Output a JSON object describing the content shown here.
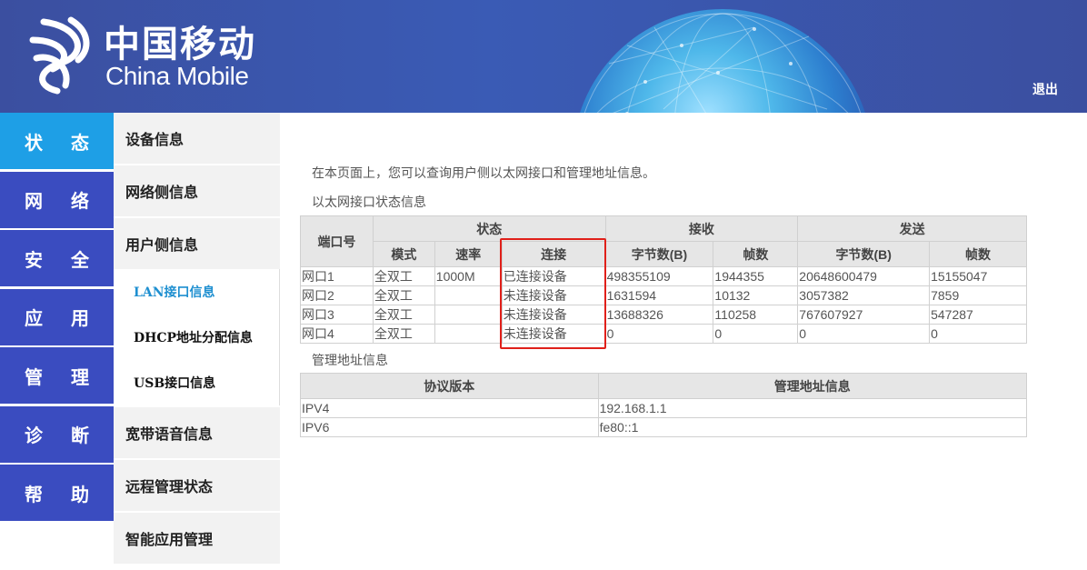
{
  "header": {
    "brand_cn": "中国移动",
    "brand_en": "China Mobile",
    "logout": "退出"
  },
  "main_nav": [
    {
      "label": "状 态",
      "active": true
    },
    {
      "label": "网 络"
    },
    {
      "label": "安 全"
    },
    {
      "label": "应 用"
    },
    {
      "label": "管 理"
    },
    {
      "label": "诊 断"
    },
    {
      "label": "帮 助"
    }
  ],
  "sub_nav": {
    "device_info": "设备信息",
    "network_side": "网络侧信息",
    "user_side": "用户侧信息",
    "lan_info": "LAN接口信息",
    "dhcp_info": "DHCP地址分配信息",
    "usb_info": "USB接口信息",
    "voice_info": "宽带语音信息",
    "remote_mgmt": "远程管理状态",
    "smart_app": "智能应用管理"
  },
  "content": {
    "intro": "在本页面上，您可以查询用户侧以太网接口和管理地址信息。",
    "eth_title": "以太网接口状态信息",
    "mgmt_title": "管理地址信息"
  },
  "eth_table": {
    "h_port": "端口号",
    "h_status": "状态",
    "h_recv": "接收",
    "h_send": "发送",
    "h_mode": "模式",
    "h_rate": "速率",
    "h_conn": "连接",
    "h_recv_bytes": "字节数(B)",
    "h_recv_frames": "帧数",
    "h_send_bytes": "字节数(B)",
    "h_send_frames": "帧数",
    "rows": [
      {
        "port": "网口1",
        "mode": "全双工",
        "rate": "1000M",
        "conn": "已连接设备",
        "rx_bytes": "498355109",
        "rx_frames": "1944355",
        "tx_bytes": "20648600479",
        "tx_frames": "15155047"
      },
      {
        "port": "网口2",
        "mode": "全双工",
        "rate": "",
        "conn": "未连接设备",
        "rx_bytes": "1631594",
        "rx_frames": "10132",
        "tx_bytes": "3057382",
        "tx_frames": "7859"
      },
      {
        "port": "网口3",
        "mode": "全双工",
        "rate": "",
        "conn": "未连接设备",
        "rx_bytes": "13688326",
        "rx_frames": "110258",
        "tx_bytes": "767607927",
        "tx_frames": "547287"
      },
      {
        "port": "网口4",
        "mode": "全双工",
        "rate": "",
        "conn": "未连接设备",
        "rx_bytes": "0",
        "rx_frames": "0",
        "tx_bytes": "0",
        "tx_frames": "0"
      }
    ]
  },
  "mgmt_table": {
    "h_proto": "协议版本",
    "h_addr": "管理地址信息",
    "rows": [
      {
        "proto": "IPV4",
        "addr": "192.168.1.1"
      },
      {
        "proto": "IPV6",
        "addr": "fe80::1"
      }
    ]
  },
  "colors": {
    "header_bg": "#3a55b0",
    "nav_bg": "#3a4cc0",
    "nav_active": "#1e9fe6",
    "highlight": "#e0201a"
  }
}
